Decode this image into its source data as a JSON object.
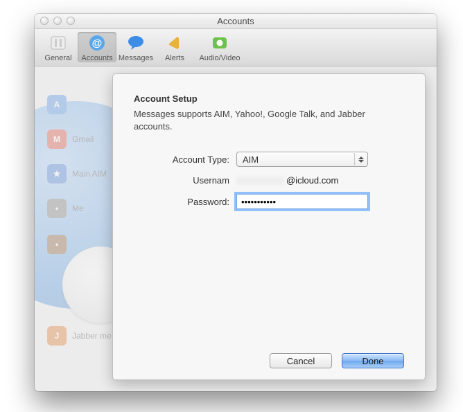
{
  "window": {
    "title": "Accounts"
  },
  "toolbar": {
    "general": {
      "label": "General"
    },
    "accounts": {
      "label": "Accounts"
    },
    "messages": {
      "label": "Messages"
    },
    "alerts": {
      "label": "Alerts"
    },
    "av": {
      "label": "Audio/Video"
    }
  },
  "bg_sidebar": {
    "item1": "Gmail",
    "item2": "Main AIM",
    "item3": "Me",
    "item5": "Jabber me"
  },
  "sheet": {
    "heading": "Account Setup",
    "description": "Messages supports AIM, Yahoo!, Google Talk, and Jabber accounts.",
    "account_type_label": "Account Type:",
    "account_type_value": "AIM",
    "username_label": "Usernam",
    "username_suffix": "@icloud.com",
    "password_label": "Password:",
    "password_value": "•••••••••••",
    "cancel": "Cancel",
    "done": "Done"
  }
}
